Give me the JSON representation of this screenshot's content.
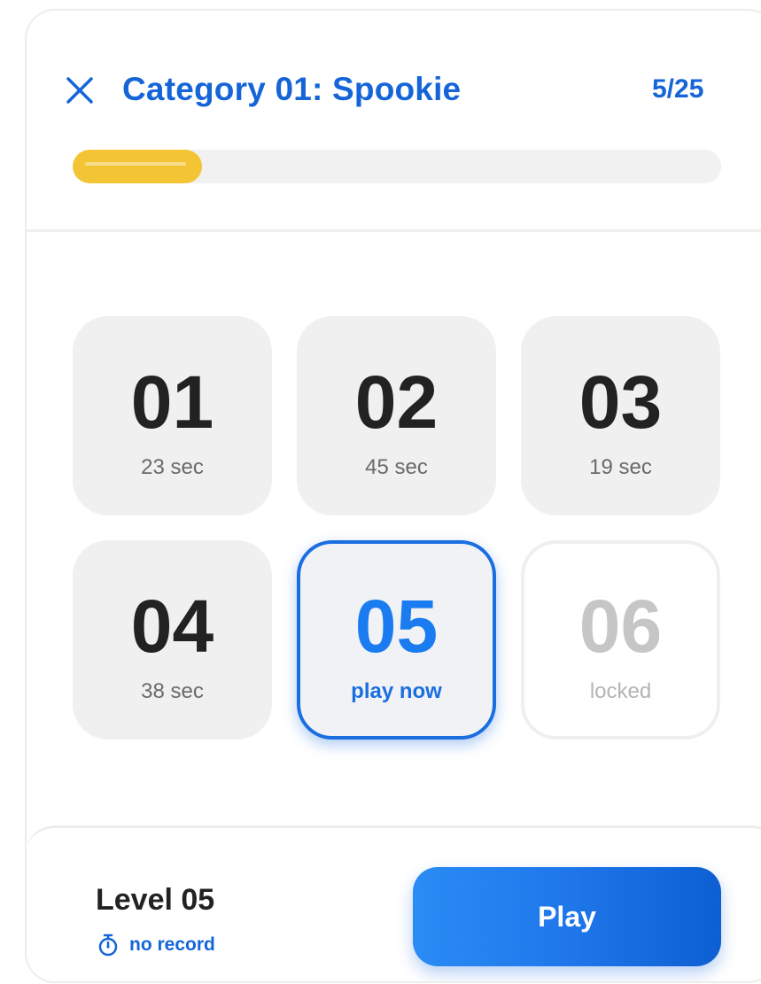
{
  "header": {
    "close_icon": "close-x-icon",
    "title": "Category 01: Spookie",
    "counter": "5/25",
    "progress": 0.2,
    "progress_color": "#f3c534"
  },
  "levels": [
    {
      "number": "01",
      "subtitle": "23 sec",
      "state": "completed"
    },
    {
      "number": "02",
      "subtitle": "45 sec",
      "state": "completed"
    },
    {
      "number": "03",
      "subtitle": "19 sec",
      "state": "completed"
    },
    {
      "number": "04",
      "subtitle": "38 sec",
      "state": "completed"
    },
    {
      "number": "05",
      "subtitle": "play now",
      "state": "current"
    },
    {
      "number": "06",
      "subtitle": "locked",
      "state": "locked"
    }
  ],
  "footer": {
    "level_label": "Level 05",
    "record_icon": "stopwatch-icon",
    "record_text": "no record",
    "play_label": "Play"
  },
  "colors": {
    "accent": "#1565d8",
    "progress": "#f3c534",
    "tile_bg": "#f0f0f0"
  }
}
